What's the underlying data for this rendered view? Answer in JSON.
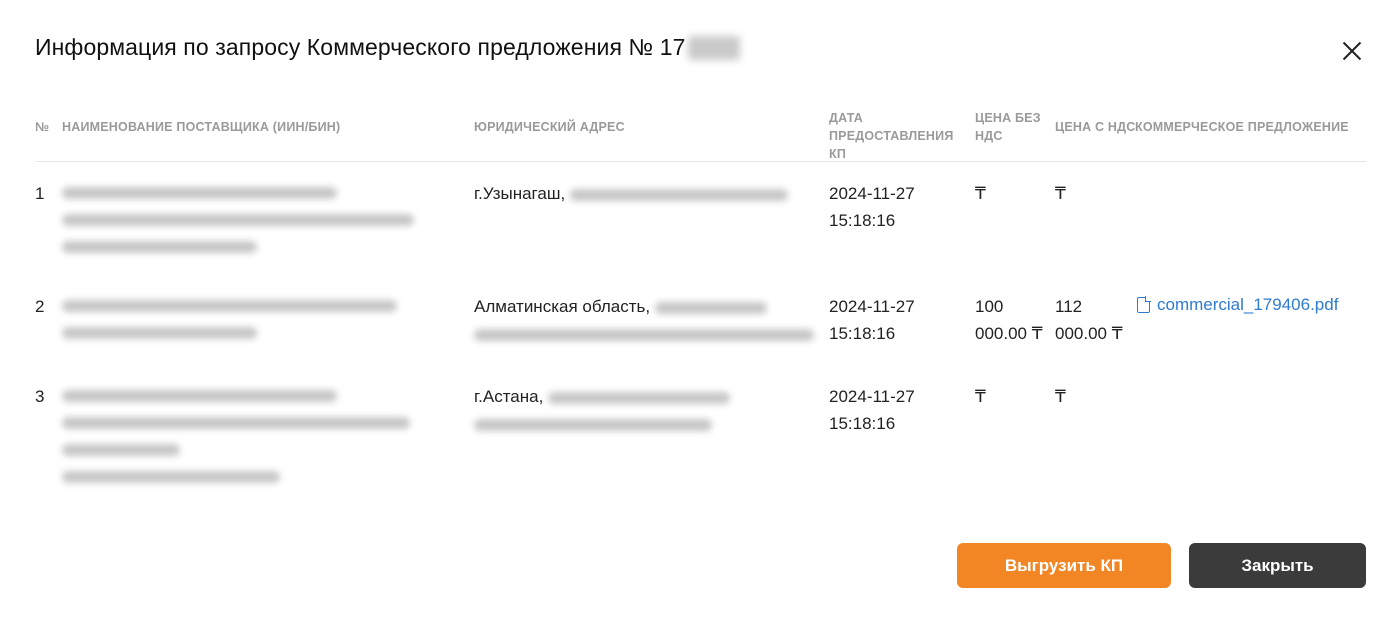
{
  "dialog": {
    "title": "Информация по запросу Коммерческого предложения № 17"
  },
  "table": {
    "headers": {
      "num": "№",
      "supplier": "НАИМЕНОВАНИЕ ПОСТАВЩИКА (ИИН/БИН)",
      "address": "ЮРИДИЧЕСКИЙ АДРЕС",
      "date": "ДАТА ПРЕДОСТАВЛЕНИЯ КП",
      "price_no_vat": "ЦЕНА БЕЗ НДС",
      "price_vat": "ЦЕНА С НДС",
      "offer": "КОММЕРЧЕСКОЕ ПРЕДЛОЖЕНИЕ"
    },
    "rows": [
      {
        "num": "1",
        "address": "г.Узынагаш,",
        "date": "2024-11-27",
        "time": "15:18:16",
        "price_no_vat": "₸",
        "price_vat": "₸",
        "file": ""
      },
      {
        "num": "2",
        "address": "Алматинская область,",
        "date": "2024-11-27",
        "time": "15:18:16",
        "price_no_vat_1": "100",
        "price_no_vat_2": "000.00 ₸",
        "price_vat_1": "112",
        "price_vat_2": "000.00 ₸",
        "file": "commercial_179406.pdf"
      },
      {
        "num": "3",
        "address": "г.Астана,",
        "date": "2024-11-27",
        "time": "15:18:16",
        "price_no_vat": "₸",
        "price_vat": "₸",
        "file": ""
      }
    ]
  },
  "buttons": {
    "export": "Выгрузить КП",
    "close": "Закрыть"
  },
  "icons": {
    "close": "close-icon",
    "file": "file-icon"
  },
  "colors": {
    "accent": "#f28624",
    "dark_button": "#3b3b3b",
    "link": "#2e7bd0"
  }
}
